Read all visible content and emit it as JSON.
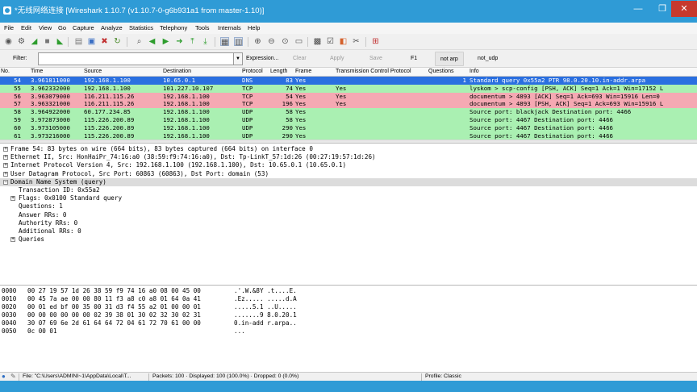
{
  "window": {
    "title": "*无线网络连接 [Wireshark 1.10.7 (v1.10.7-0-g6b931a1 from master-1.10)]",
    "minimize": "—",
    "maximize": "❐",
    "close": "✕"
  },
  "menu": [
    "File",
    "Edit",
    "View",
    "Go",
    "Capture",
    "Analyze",
    "Statistics",
    "Telephony",
    "Tools",
    "Internals",
    "Help"
  ],
  "filter": {
    "label": "Filter:",
    "value": "",
    "buttons": {
      "expression": "Expression...",
      "clear": "Clear",
      "apply": "Apply",
      "save": "Save",
      "f1": "F1",
      "not_arp": "not arp",
      "not_udp": "not_udp"
    }
  },
  "columns": [
    "No.",
    "Time",
    "Source",
    "Destination",
    "Protocol",
    "Length",
    "Frame",
    "Transmission Control Protocol",
    "Questions",
    "Info"
  ],
  "packets": [
    {
      "no": "54",
      "time": "3.961811000",
      "src": "192.168.1.100",
      "dst": "10.65.0.1",
      "proto": "DNS",
      "len": "83",
      "frame": "Yes",
      "tcp": "",
      "q": "1",
      "info": "Standard query 0x55a2  PTR 98.0.20.10.in-addr.arpa",
      "color": "#2a6fe0",
      "text_color": "#ffffff"
    },
    {
      "no": "55",
      "time": "3.962332000",
      "src": "192.168.1.100",
      "dst": "101.227.10.107",
      "proto": "TCP",
      "len": "74",
      "frame": "Yes",
      "tcp": "Yes",
      "q": "",
      "info": "lyskom > scp-config [PSH, ACK] Seq=1 Ack=1 Win=17152 L",
      "color": "#aaf0b2",
      "text_color": "#000000"
    },
    {
      "no": "56",
      "time": "3.963079000",
      "src": "116.211.115.26",
      "dst": "192.168.1.100",
      "proto": "TCP",
      "len": "54",
      "frame": "Yes",
      "tcp": "Yes",
      "q": "",
      "info": "documentum > 4893 [ACK] Seq=1 Ack=693 Win=15916 Len=0",
      "color": "#f5a9b3",
      "text_color": "#000000"
    },
    {
      "no": "57",
      "time": "3.963321000",
      "src": "116.211.115.26",
      "dst": "192.168.1.100",
      "proto": "TCP",
      "len": "196",
      "frame": "Yes",
      "tcp": "Yes",
      "q": "",
      "info": "documentum > 4893 [PSH, ACK] Seq=1 Ack=693 Win=15916 L",
      "color": "#f5a9b3",
      "text_color": "#000000"
    },
    {
      "no": "58",
      "time": "3.964922000",
      "src": "60.177.234.85",
      "dst": "192.168.1.100",
      "proto": "UDP",
      "len": "58",
      "frame": "Yes",
      "tcp": "",
      "q": "",
      "info": "Source port: blackjack  Destination port: 4466",
      "color": "#aaf0b2",
      "text_color": "#000000"
    },
    {
      "no": "59",
      "time": "3.972873000",
      "src": "115.226.200.89",
      "dst": "192.168.1.100",
      "proto": "UDP",
      "len": "58",
      "frame": "Yes",
      "tcp": "",
      "q": "",
      "info": "Source port: 4467  Destination port: 4466",
      "color": "#aaf0b2",
      "text_color": "#000000"
    },
    {
      "no": "60",
      "time": "3.973105000",
      "src": "115.226.200.89",
      "dst": "192.168.1.100",
      "proto": "UDP",
      "len": "290",
      "frame": "Yes",
      "tcp": "",
      "q": "",
      "info": "Source port: 4467  Destination port: 4466",
      "color": "#aaf0b2",
      "text_color": "#000000"
    },
    {
      "no": "61",
      "time": "3.973216000",
      "src": "115.226.200.89",
      "dst": "192.168.1.100",
      "proto": "UDP",
      "len": "290",
      "frame": "Yes",
      "tcp": "",
      "q": "",
      "info": "Source port: 4467  Destination port: 4466",
      "color": "#aaf0b2",
      "text_color": "#000000"
    }
  ],
  "details": [
    {
      "indent": 0,
      "exp": "+",
      "text": "Frame 54: 83 bytes on wire (664 bits), 83 bytes captured (664 bits) on interface 0"
    },
    {
      "indent": 0,
      "exp": "+",
      "text": "Ethernet II, Src: HonHaiPr_74:16:a0 (38:59:f9:74:16:a0), Dst: Tp-LinkT_57:1d:26 (00:27:19:57:1d:26)"
    },
    {
      "indent": 0,
      "exp": "+",
      "text": "Internet Protocol Version 4, Src: 192.168.1.100 (192.168.1.100), Dst: 10.65.0.1 (10.65.0.1)"
    },
    {
      "indent": 0,
      "exp": "+",
      "text": "User Datagram Protocol, Src Port: 60863 (60863), Dst Port: domain (53)"
    },
    {
      "indent": 0,
      "exp": "−",
      "text": "Domain Name System (query)",
      "selected": true
    },
    {
      "indent": 1,
      "exp": "",
      "text": "Transaction ID: 0x55a2"
    },
    {
      "indent": 1,
      "exp": "+",
      "text": "Flags: 0x0100 Standard query"
    },
    {
      "indent": 1,
      "exp": "",
      "text": "Questions: 1"
    },
    {
      "indent": 1,
      "exp": "",
      "text": "Answer RRs: 0"
    },
    {
      "indent": 1,
      "exp": "",
      "text": "Authority RRs: 0"
    },
    {
      "indent": 1,
      "exp": "",
      "text": "Additional RRs: 0"
    },
    {
      "indent": 1,
      "exp": "+",
      "text": "Queries"
    }
  ],
  "hex": [
    {
      "off": "0000",
      "bytes": "00 27 19 57 1d 26 38 59  f9 74 16 a0 08 00 45 00",
      "ascii": ".'.W.&8Y .t....E."
    },
    {
      "off": "0010",
      "bytes": "00 45 7a ae 00 00 80 11  f3 a8 c0 a8 01 64 0a 41",
      "ascii": ".Ez..... .....d.A"
    },
    {
      "off": "0020",
      "bytes": "00 01 ed bf 00 35 00 31  d3 f4 55 a2 01 00 00 01",
      "ascii": ".....5.1 ..U....."
    },
    {
      "off": "0030",
      "bytes": "00 00 00 00 00 00 02 39  38 01 30 02 32 30 02 31",
      "ascii": ".......9 8.0.20.1"
    },
    {
      "off": "0040",
      "bytes": "30 07 69 6e 2d 61 64 64  72 04 61 72 70 61 00 00",
      "ascii": "0.in-add r.arpa.."
    },
    {
      "off": "0050",
      "bytes": "0c 00 01",
      "ascii": "..."
    }
  ],
  "status": {
    "file": "File: \"C:\\Users\\ADMINI~1\\AppData\\Local\\T...",
    "packets": "Packets: 100 · Displayed: 100 (100.0%) · Dropped: 0 (0.0%)",
    "profile": "Profile: Classic"
  },
  "colors": {
    "accent": "#2f9bd6",
    "selected_row": "#2a6fe0",
    "tcp_green": "#aaf0b2",
    "tcp_error": "#f5a9b3"
  }
}
